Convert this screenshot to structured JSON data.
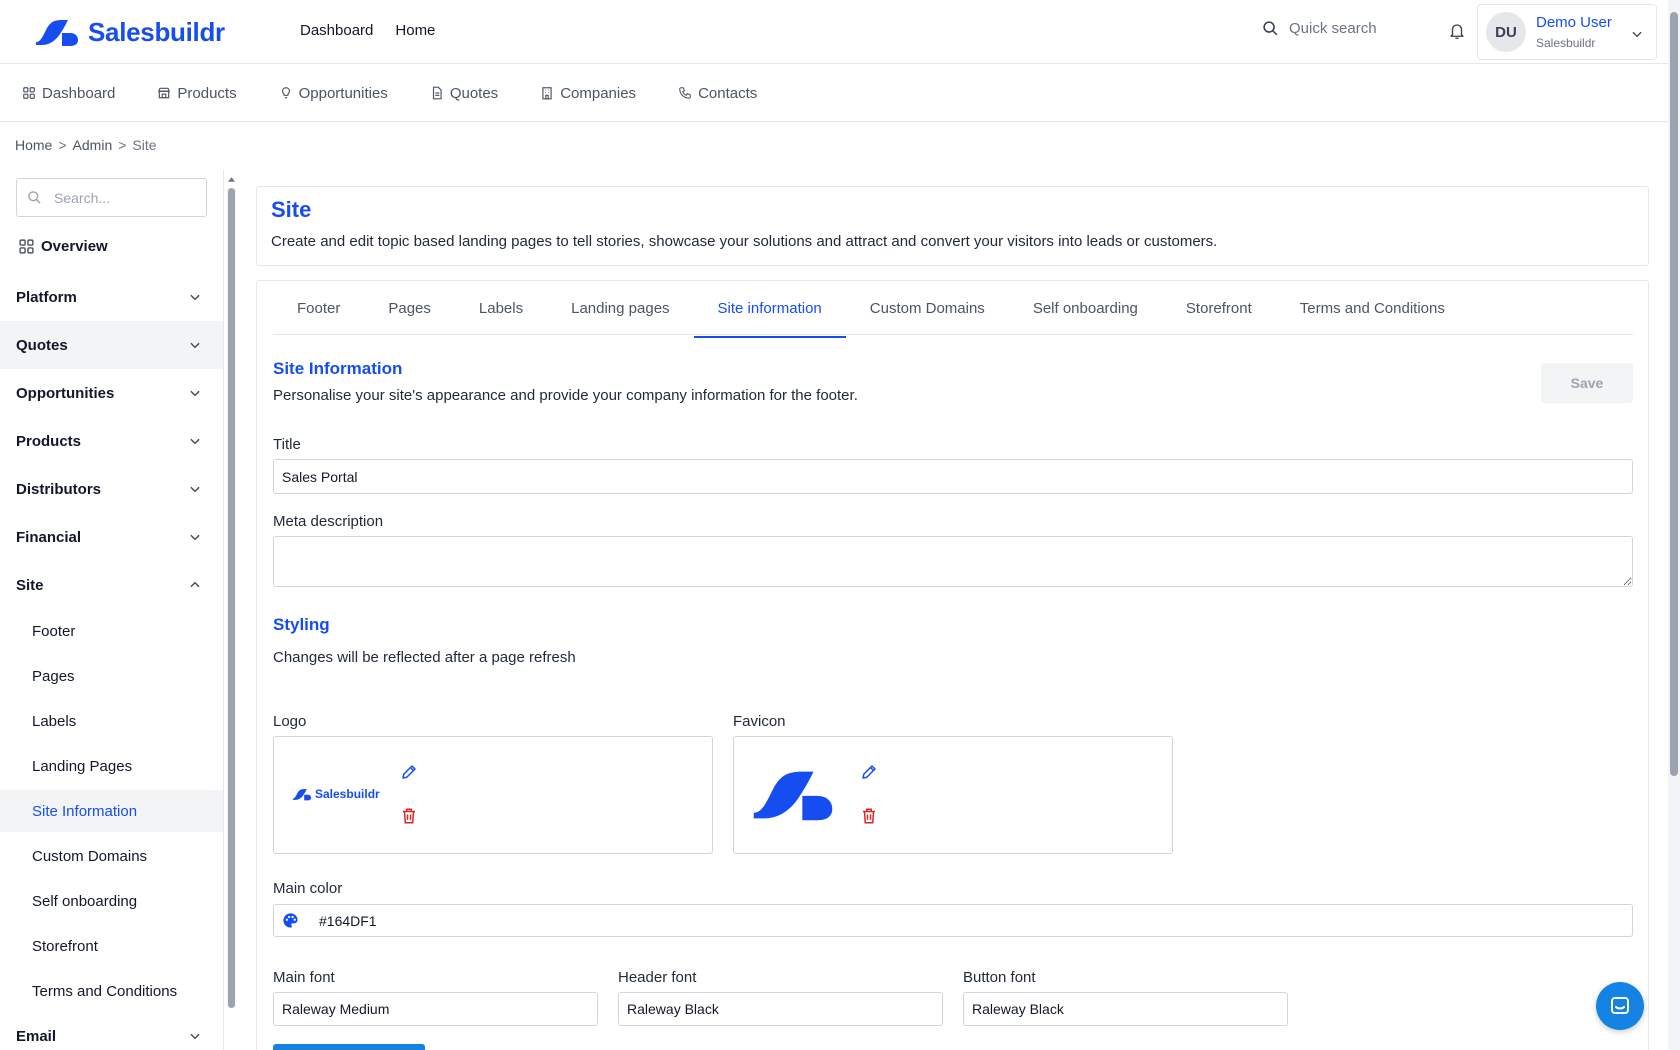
{
  "brand": {
    "name": "Salesbuildr",
    "color": "#164DF1"
  },
  "topnav": {
    "items": [
      "Dashboard",
      "Home"
    ]
  },
  "search": {
    "placeholder": "Quick search"
  },
  "user": {
    "initials": "DU",
    "name": "Demo User",
    "company": "Salesbuildr"
  },
  "subnav": {
    "items": [
      {
        "label": "Dashboard",
        "icon": "dashboard-icon"
      },
      {
        "label": "Products",
        "icon": "store-icon"
      },
      {
        "label": "Opportunities",
        "icon": "lightbulb-icon"
      },
      {
        "label": "Quotes",
        "icon": "document-icon"
      },
      {
        "label": "Companies",
        "icon": "building-icon"
      },
      {
        "label": "Contacts",
        "icon": "phone-icon"
      }
    ]
  },
  "breadcrumb": {
    "items": [
      "Home",
      "Admin",
      "Site"
    ],
    "separator": ">"
  },
  "sidebar": {
    "search_placeholder": "Search...",
    "overview": "Overview",
    "sections": [
      "Platform",
      "Quotes",
      "Opportunities",
      "Products",
      "Distributors",
      "Financial",
      "Site"
    ],
    "site_items": [
      "Footer",
      "Pages",
      "Labels",
      "Landing Pages",
      "Site Information",
      "Custom Domains",
      "Self onboarding",
      "Storefront",
      "Terms and Conditions"
    ],
    "email": "Email"
  },
  "hero": {
    "title": "Site",
    "description": "Create and edit topic based landing pages to tell stories, showcase your solutions and attract and convert your visitors into leads or customers."
  },
  "tabs": [
    "Footer",
    "Pages",
    "Labels",
    "Landing pages",
    "Site information",
    "Custom Domains",
    "Self onboarding",
    "Storefront",
    "Terms and Conditions"
  ],
  "active_tab": "Site information",
  "site_info": {
    "title": "Site Information",
    "description": "Personalise your site's appearance and provide your company information for the footer.",
    "save_label": "Save",
    "title_label": "Title",
    "title_value": "Sales Portal",
    "meta_label": "Meta description",
    "meta_value": ""
  },
  "styling": {
    "title": "Styling",
    "description": "Changes will be reflected after a page refresh",
    "logo_label": "Logo",
    "logo_text": "Salesbuildr",
    "favicon_label": "Favicon",
    "main_color_label": "Main color",
    "main_color_value": "#164DF1",
    "main_font_label": "Main font",
    "main_font_value": "Raleway Medium",
    "header_font_label": "Header font",
    "header_font_value": "Raleway Black",
    "button_font_label": "Button font",
    "button_font_value": "Raleway Black"
  },
  "colors": {
    "accent": "#164DF1",
    "danger": "#dc2626",
    "fab": "#1483e3"
  }
}
